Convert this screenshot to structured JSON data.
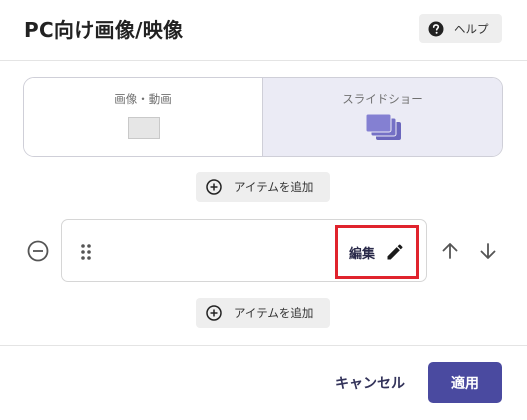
{
  "dialog": {
    "title": "PC向け画像/映像",
    "help_label": "ヘルプ"
  },
  "mode_toggle": {
    "options": [
      {
        "label": "画像・動画",
        "icon": "image-placeholder-icon",
        "selected": false
      },
      {
        "label": "スライドショー",
        "icon": "slideshow-stack-icon",
        "selected": true
      }
    ]
  },
  "items": {
    "add_label_top": "アイテムを追加",
    "add_label_bottom": "アイテムを追加",
    "list": [
      {
        "edit_label": "編集"
      }
    ]
  },
  "footer": {
    "cancel_label": "キャンセル",
    "apply_label": "適用"
  },
  "colors": {
    "primary": "#4a4aa0",
    "selected_segment": "#ebebf5",
    "slideshow_icon": "#7b77c9",
    "highlight_border": "#e0232d"
  }
}
